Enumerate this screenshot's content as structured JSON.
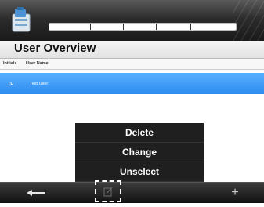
{
  "header": {
    "app_icon": "app-logo-icon"
  },
  "page": {
    "title": "User Overview"
  },
  "table": {
    "columns": [
      "Initials",
      "User Name"
    ],
    "rows": [
      {
        "initials": "TU",
        "user_name": "Test User",
        "selected": true
      }
    ]
  },
  "context_menu": {
    "items": [
      "Delete",
      "Change",
      "Unselect"
    ]
  },
  "toolbar": {
    "back_icon": "back-arrow-icon",
    "edit_icon": "edit-icon",
    "add_label": "+"
  },
  "colors": {
    "header_bg": "#2c2c2c",
    "selection": "#2d8cf0",
    "menu_bg": "#1f1f1f"
  }
}
